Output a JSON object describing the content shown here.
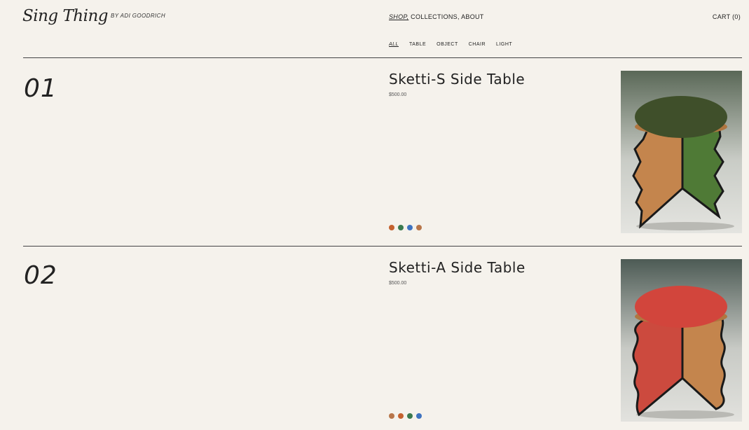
{
  "header": {
    "logo": "Sing Thing",
    "byline": "BY ADI GOODRICH",
    "nav": [
      {
        "label": "SHOP,",
        "active": true
      },
      {
        "label": " COLLECTIONS,",
        "active": false
      },
      {
        "label": " ABOUT",
        "active": false
      }
    ],
    "cart_label": "CART (0)"
  },
  "filters": [
    {
      "label": "ALL",
      "active": true
    },
    {
      "label": "TABLE",
      "active": false
    },
    {
      "label": "OBJECT",
      "active": false
    },
    {
      "label": "CHAIR",
      "active": false
    },
    {
      "label": "LIGHT",
      "active": false
    }
  ],
  "products": [
    {
      "number": "01",
      "title": "Sketti-S Side Table",
      "price": "$500.00",
      "swatches": [
        "#c4622f",
        "#3a7a4f",
        "#3f73c0",
        "#b8764a"
      ],
      "top_color": "#3f4f2a",
      "leg_color": "#4f7a36",
      "backdrop": "#5b6a5a"
    },
    {
      "number": "02",
      "title": "Sketti-A Side Table",
      "price": "$500.00",
      "swatches": [
        "#b8764a",
        "#c4622f",
        "#3a7a4f",
        "#3f73c0"
      ],
      "top_color": "#d2453c",
      "leg_color": "#cc4a3e",
      "backdrop": "#4f5d58"
    }
  ]
}
